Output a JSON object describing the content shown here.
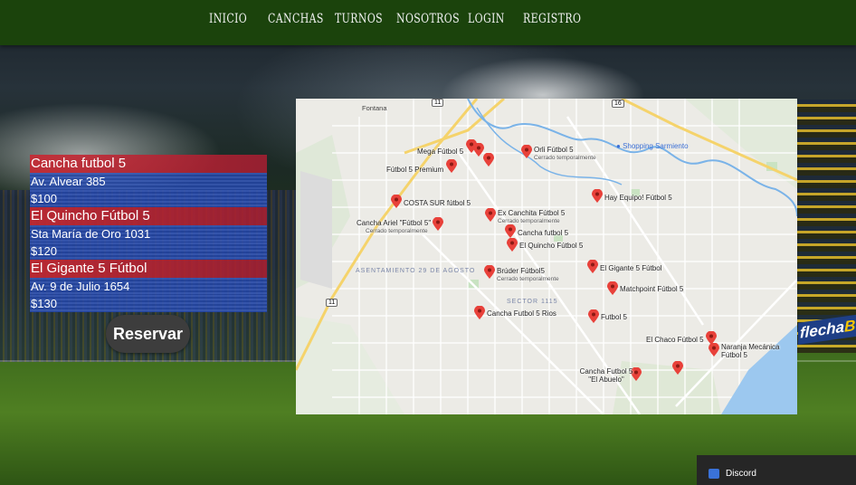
{
  "nav": {
    "items": [
      "INICIO",
      "CANCHAS",
      "TURNOS",
      "NOSOTROS",
      "LOGIN",
      "REGISTRO"
    ]
  },
  "listing": [
    {
      "name": "Cancha futbol 5",
      "address": "Av. Alvear 385",
      "price": "$100"
    },
    {
      "name": "El Quincho Fútbol 5",
      "address": "Sta María de Oro 1031",
      "price": "$120"
    },
    {
      "name": "El Gigante 5 Fútbol",
      "address": "Av. 9 de Julio 1654",
      "price": "$130"
    }
  ],
  "reserve_label": "Reservar",
  "background_ad": {
    "part1": "flecha",
    "part2": "BU"
  },
  "map": {
    "town": "Fontana",
    "poi": "Shopping Sarmiento",
    "area_labels": [
      "ASENTAMIENTO 29 DE AGOSTO",
      "SECTOR 1115"
    ],
    "route_shields": [
      "11",
      "16",
      "11"
    ],
    "places": [
      {
        "name": "Mega Fútbol 5",
        "sub": ""
      },
      {
        "name": "Orli Fútbol 5",
        "sub": "Cerrado temporalmente"
      },
      {
        "name": "Fútbol 5 Premium",
        "sub": ""
      },
      {
        "name": "Hay Equipo! Fútbol 5",
        "sub": ""
      },
      {
        "name": "COSTA SUR fútbol 5",
        "sub": ""
      },
      {
        "name": "Ex Canchita Fútbol 5",
        "sub": "Cerrado temporalmente"
      },
      {
        "name": "Cancha Ariel \"Fútbol 5\"",
        "sub": "Cerrado temporalmente"
      },
      {
        "name": "Cancha futbol 5",
        "sub": ""
      },
      {
        "name": "El Quincho Fútbol 5",
        "sub": ""
      },
      {
        "name": "El Gigante 5 Fútbol",
        "sub": ""
      },
      {
        "name": "Brúder Fútbol5",
        "sub": "Cerrado temporalmente"
      },
      {
        "name": "Matchpoint Fútbol 5",
        "sub": ""
      },
      {
        "name": "Cancha Futbol 5 Rios",
        "sub": ""
      },
      {
        "name": "Futbol 5",
        "sub": ""
      },
      {
        "name": "El Chaco Fútbol 5",
        "sub": ""
      },
      {
        "name": "Naranja Mecánica Fútbol 5",
        "sub": ""
      },
      {
        "name": "Cancha Futbol 5 \"El Abuelo\"",
        "sub": ""
      }
    ]
  },
  "taskbar": {
    "discord_label": "Discord"
  },
  "colors": {
    "nav": "#1b430c",
    "pin": "#e8413a",
    "river": "#7ab3e8",
    "row_red": "#c82832",
    "row_blue": "#2346aa"
  }
}
